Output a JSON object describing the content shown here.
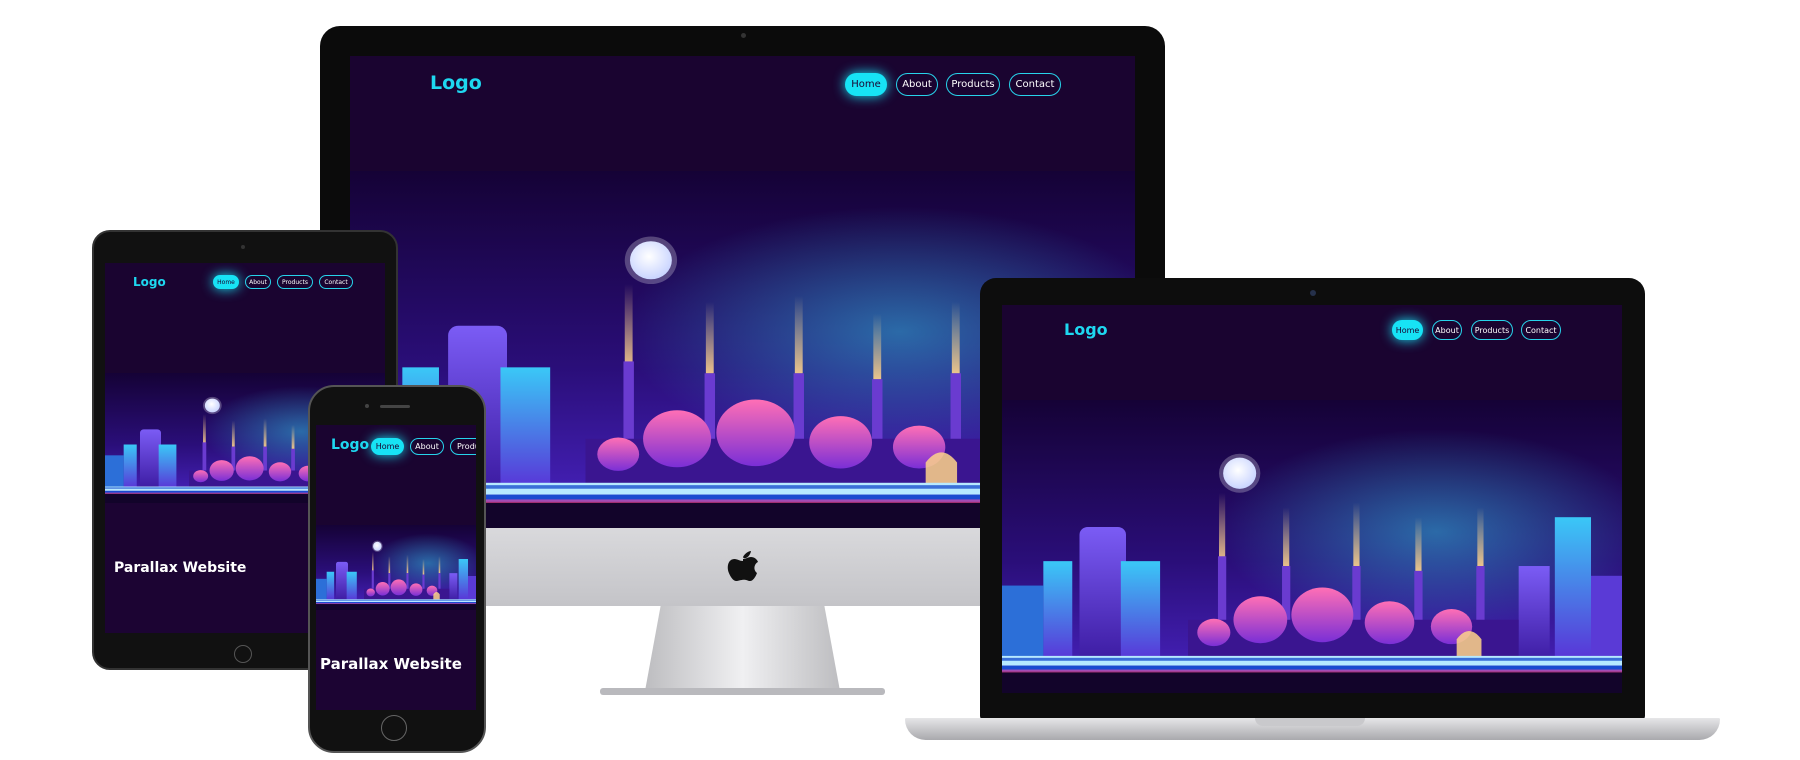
{
  "site": {
    "logo": "Logo",
    "nav": [
      "Home",
      "About",
      "Products",
      "Contact"
    ],
    "active_nav": "Home",
    "hero_title": "Parallax Website",
    "phone_nav_truncated": "Produ"
  },
  "colors": {
    "background": "#1c0433",
    "accent": "#1ed8f0",
    "sky_top": "#130232",
    "sky_bottom": "#3a1aa8"
  },
  "devices": [
    "desktop-monitor",
    "laptop",
    "tablet",
    "phone"
  ],
  "icons": [
    "apple-logo-icon",
    "moon-icon",
    "city-skyline-icon"
  ]
}
